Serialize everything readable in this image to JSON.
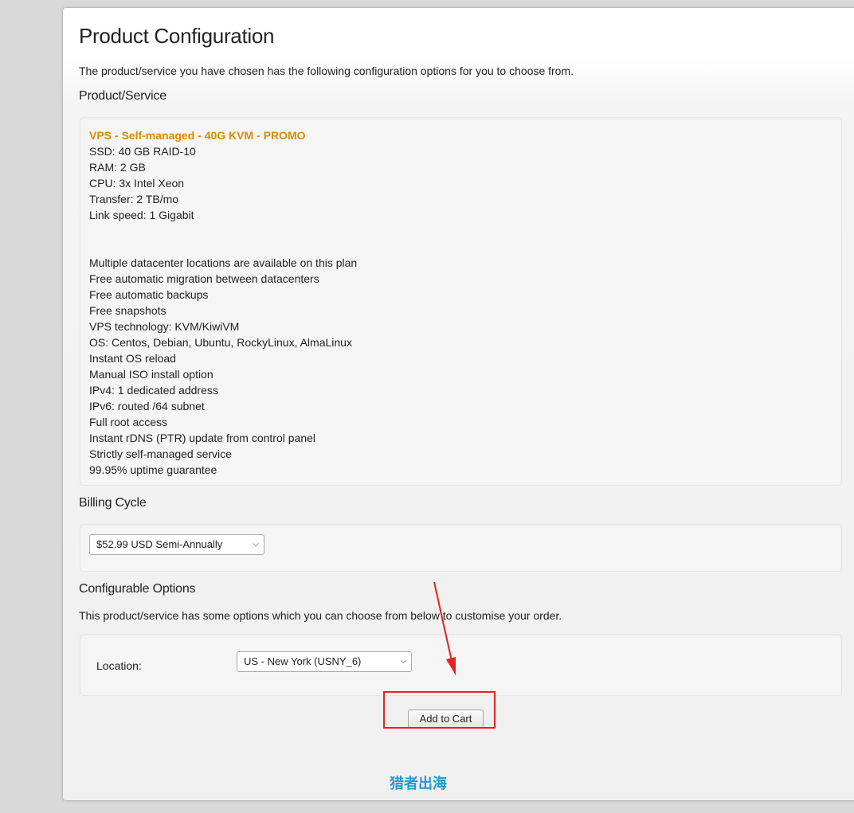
{
  "page": {
    "title": "Product Configuration",
    "intro": "The product/service you have chosen has the following configuration options for you to choose from."
  },
  "product_section": {
    "heading": "Product/Service",
    "name": "VPS - Self-managed - 40G KVM - PROMO",
    "specs": [
      "SSD: 40 GB RAID-10",
      "RAM: 2 GB",
      "CPU: 3x Intel Xeon",
      "Transfer: 2 TB/mo",
      "Link speed: 1 Gigabit"
    ],
    "features": [
      "Multiple datacenter locations are available on this plan",
      "Free automatic migration between datacenters",
      "Free automatic backups",
      "Free snapshots",
      "VPS technology: KVM/KiwiVM",
      "OS: Centos, Debian, Ubuntu, RockyLinux, AlmaLinux",
      "Instant OS reload",
      "Manual ISO install option",
      "IPv4: 1 dedicated address",
      "IPv6: routed /64 subnet",
      "Full root access",
      "Instant rDNS (PTR) update from control panel",
      "Strictly self-managed service",
      "99.95% uptime guarantee"
    ]
  },
  "billing": {
    "heading": "Billing Cycle",
    "selected": "$52.99 USD Semi-Annually"
  },
  "configurable_options": {
    "heading": "Configurable Options",
    "intro": "This product/service has some options which you can choose from below to customise your order.",
    "location_label": "Location:",
    "location_selected": "US - New York (USNY_6)"
  },
  "actions": {
    "add_to_cart": "Add to Cart"
  },
  "watermark": "猎者出海",
  "colors": {
    "product_name": "#e08a00",
    "annotation_red": "#e32222",
    "watermark_blue": "#1f9ad6"
  }
}
